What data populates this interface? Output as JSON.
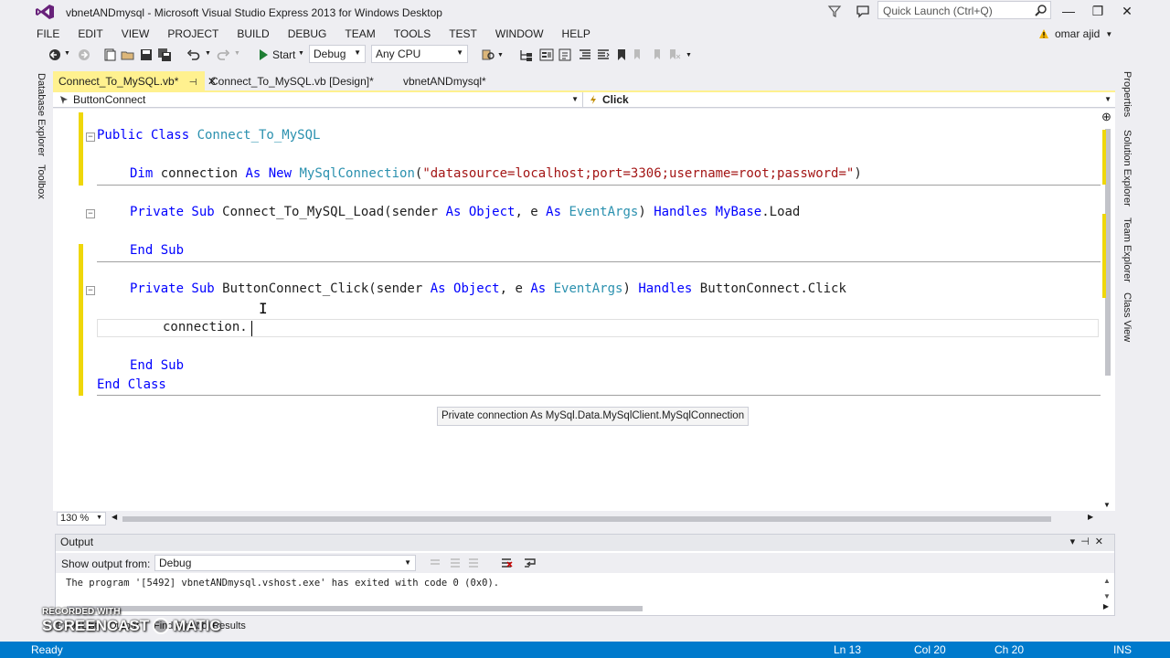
{
  "window": {
    "title": "vbnetANDmysql - Microsoft Visual Studio Express 2013 for Windows Desktop",
    "quick_launch_placeholder": "Quick Launch (Ctrl+Q)",
    "user": "omar ajid",
    "minimize": "—",
    "restore": "❐",
    "close": "✕"
  },
  "menu": [
    "FILE",
    "EDIT",
    "VIEW",
    "PROJECT",
    "BUILD",
    "DEBUG",
    "TEAM",
    "TOOLS",
    "TEST",
    "WINDOW",
    "HELP"
  ],
  "toolbar": {
    "start_label": "Start",
    "config_value": "Debug",
    "platform_value": "Any CPU"
  },
  "left_tabs": [
    "Database Explorer",
    "Toolbox"
  ],
  "right_tabs": [
    "Properties",
    "Solution Explorer",
    "Team Explorer",
    "Class View"
  ],
  "doc_tabs": [
    {
      "label": "Connect_To_MySQL.vb*",
      "active": true
    },
    {
      "label": "Connect_To_MySQL.vb [Design]*",
      "active": false
    },
    {
      "label": "vbnetANDmysql*",
      "active": false
    }
  ],
  "navbar": {
    "left_value": "ButtonConnect",
    "right_value": "Click"
  },
  "code": {
    "line1": {
      "kw": "Public Class ",
      "name": "Connect_To_MySQL"
    },
    "line2": {
      "kw1": "Dim",
      "id": " connection ",
      "kw2": "As New",
      "type": " MySqlConnection",
      "p1": "(",
      "str": "\"datasource=localhost;port=3306;username=root;password=\"",
      "p2": ")"
    },
    "line3": {
      "kw1": "Private Sub",
      "t1": " Connect_To_MySQL_Load(sender ",
      "kw2": "As Object",
      "t2": ", e ",
      "kw3": "As",
      "type": " EventArgs",
      "t3": ") ",
      "kw4": "Handles",
      "t4": " ",
      "kw5": "MyBase",
      "t5": ".Load"
    },
    "line4": {
      "kw": "End Sub"
    },
    "line5": {
      "kw1": "Private Sub",
      "t1": " ButtonConnect_Click(sender ",
      "kw2": "As Object",
      "t2": ", e ",
      "kw3": "As",
      "type": " EventArgs",
      "t3": ") ",
      "kw4": "Handles",
      "t4": " ButtonConnect.Click"
    },
    "line6": {
      "text": "connection."
    },
    "line7": {
      "kw": "End Sub"
    },
    "line8": {
      "kw": "End Class"
    }
  },
  "tooltip": "Private connection As MySql.Data.MySqlClient.MySqlConnection",
  "zoom": "130 %",
  "output": {
    "title": "Output",
    "show_from_label": "Show output from:",
    "source_value": "Debug",
    "text": "The program '[5492] vbnetANDmysql.vshost.exe' has exited with code 0 (0x0)."
  },
  "bottom_tabs": [
    "Error List",
    "Output",
    "Find Symbol Results"
  ],
  "watermark": {
    "small": "RECORDED WITH",
    "big1": "SCREENCAST",
    "big2": "MATIC"
  },
  "status": {
    "state": "Ready",
    "line": "Ln 13",
    "col": "Col 20",
    "ch": "Ch 20",
    "mode": "INS"
  },
  "colors": {
    "accent": "#007acc",
    "active_tab": "#fff18f",
    "keyword": "#0000ff",
    "type": "#2b91af",
    "string": "#a31515"
  }
}
